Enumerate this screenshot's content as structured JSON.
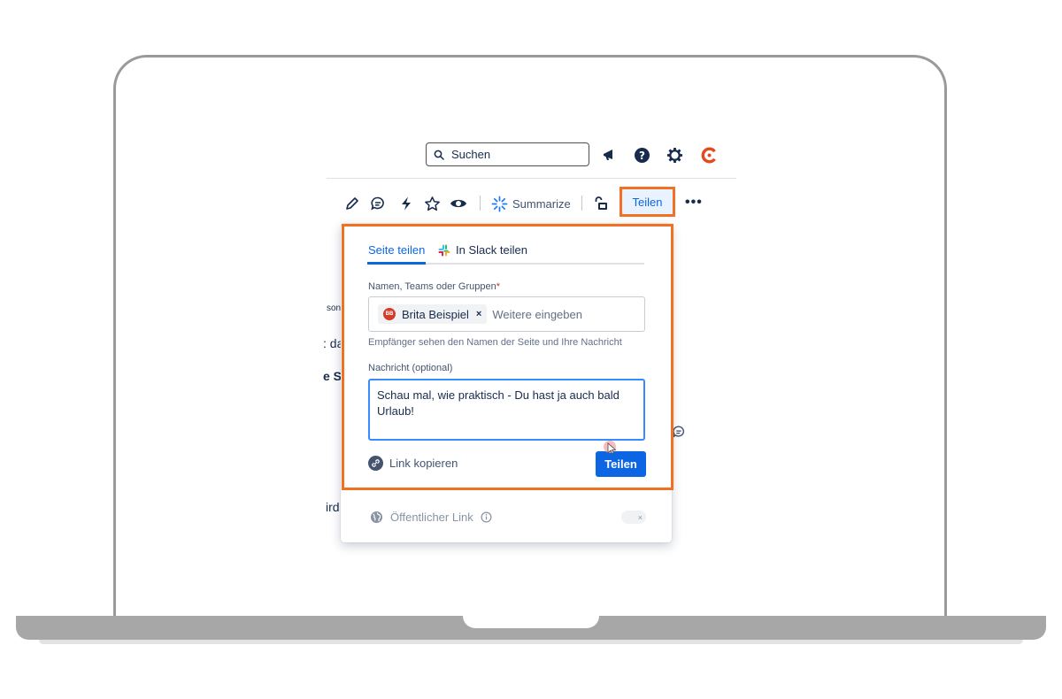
{
  "topnav": {
    "search_label": "Suchen",
    "icons": [
      "megaphone-icon",
      "help-icon",
      "settings-icon",
      "profile-avatar-icon"
    ]
  },
  "toolbar": {
    "icons": [
      "edit-icon",
      "comment-icon",
      "automation-icon",
      "star-icon",
      "watch-icon",
      "summarize-icon",
      "restrictions-icon",
      "more-icon"
    ],
    "summarize_label": "Summarize",
    "share_label": "Teilen",
    "more_label": "•••"
  },
  "background_page": {
    "fragments": [
      "son",
      ": da",
      "e Sc",
      "ird"
    ]
  },
  "share_dialog": {
    "tabs": [
      {
        "label": "Seite teilen",
        "active": true
      },
      {
        "label": "In Slack teilen",
        "active": false
      }
    ],
    "recipients_label": "Namen, Teams oder Gruppen",
    "required_marker": "*",
    "recipient_chip": {
      "initials": "BB",
      "name": "Brita Beispiel",
      "remove_label": "×"
    },
    "recipients_placeholder": "Weitere eingeben",
    "helper_text": "Empfänger sehen den Namen der Seite und Ihre Nachricht",
    "message_label": "Nachricht (optional)",
    "message_value": "Schau mal, wie praktisch - Du hast ja auch bald Urlaub!",
    "copy_link_label": "Link kopieren",
    "share_button_label": "Teilen",
    "public_link_label": "Öffentlicher Link",
    "public_link_toggle_label": "×"
  },
  "colors": {
    "highlight": "#f36f21",
    "primary": "#0c66e4",
    "avatar_red": "#d13d2a"
  }
}
